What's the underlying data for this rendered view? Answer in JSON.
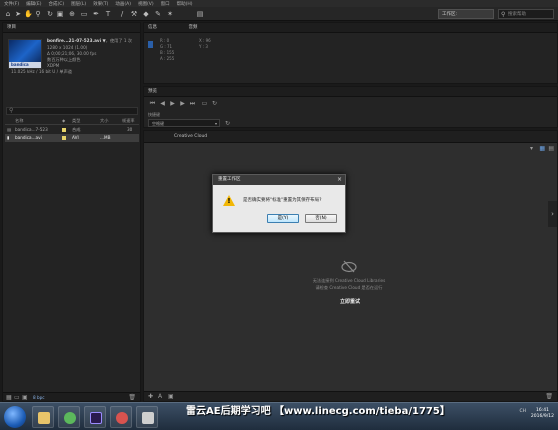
{
  "menu": [
    "文件(F)",
    "编辑(E)",
    "合成(C)",
    "图层(L)",
    "效果(T)",
    "动画(A)",
    "视图(V)",
    "窗口",
    "帮助(H)"
  ],
  "toolbar": {
    "workspace": "工作区:",
    "search_placeholder": "搜索帮助"
  },
  "project": {
    "tab": "项目",
    "file_name": "bonfire...21-07-523.avi ▼",
    "used": "，使用了 1 次",
    "resolution": "1280 x 1024 (1.00)",
    "duration": "Δ 0;00;21;06, 30.00 fps",
    "codec": "数百万种以上颜色",
    "format": "XDPM",
    "audio": "11.025 kHz / 16 bit U / 单声道",
    "columns": {
      "name": "名称",
      "label": "",
      "type": "类型",
      "size": "大小",
      "frame_rate": "帧速率"
    },
    "rows": [
      {
        "name": "bandica...7-523",
        "type": "合成",
        "size": "",
        "frame_rate": "30",
        "selected": false,
        "label_color": "#e6d36a"
      },
      {
        "name": "bandica...avi",
        "type": "AVI",
        "size": "...MB",
        "frame_rate": "",
        "selected": true,
        "label_color": "#e6d36a"
      }
    ],
    "bottom": "8 bpc"
  },
  "info": {
    "tab": "信息",
    "audio_tab": "音频",
    "rgb": "R : 0\nG : 71\nB : 155\nA : 255",
    "xy": "X : 96\nY : 3"
  },
  "preview": {
    "tab": "预览",
    "shortcut_label": "快捷键",
    "shortcut_value": "空格键"
  },
  "composition": {
    "tab": "Creative Cloud",
    "cc_line1": "无法连接到 Creative Cloud Libraries",
    "cc_line2": "请检查 Creative Cloud 是否在运行",
    "retry": "立即重试"
  },
  "dialog": {
    "title": "重置工作区",
    "message": "是否确实要将\"标准\"重置为其保存布局?",
    "yes": "是(Y)",
    "no": "否(N)"
  },
  "taskbar": {
    "watermark": "雷云AE后期学习吧 【www.linecg.com/tieba/1775】",
    "time": "16:41",
    "date": "2016/9/12",
    "tray": "CH"
  }
}
